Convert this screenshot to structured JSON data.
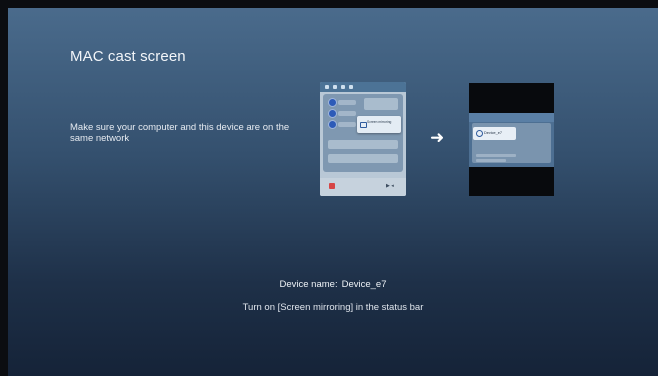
{
  "page": {
    "title": "MAC cast screen",
    "instruction": "Make sure your computer and this device are on the same network",
    "device_name_label": "Device name:",
    "device_name_value": "Device_e7",
    "hint": "Turn on [Screen mirroring] in the status bar"
  },
  "illustrations": {
    "control_center": {
      "popup_label": "Screen mirroring"
    },
    "device_picker": {
      "device_label": "Device_e7"
    },
    "arrow_icon": "right-arrow-icon"
  },
  "colors": {
    "background_top": "#4a6b8c",
    "background_bottom": "#152338",
    "text": "#f2f5f9"
  }
}
